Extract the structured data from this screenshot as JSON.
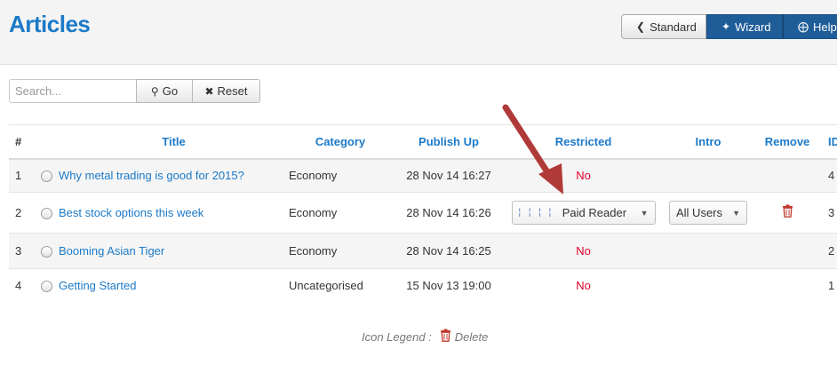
{
  "page": {
    "title": "Articles"
  },
  "toolbar": {
    "standard_label": "Standard",
    "wizard_label": "Wizard",
    "help_label": "Help",
    "standard_icon": "chevron-left-icon",
    "wizard_icon": "magic-wand-icon",
    "help_icon": "lifebuoy-icon"
  },
  "search": {
    "placeholder": "Search...",
    "value": "",
    "go_label": "Go",
    "reset_label": "Reset",
    "go_icon": "search-icon",
    "reset_icon": "close-icon"
  },
  "table": {
    "headers": [
      "#",
      "Title",
      "Category",
      "Publish Up",
      "Restricted",
      "Intro",
      "Remove",
      "ID"
    ],
    "rows": [
      {
        "num": "1",
        "title": "Why metal trading is good for 2015?",
        "category": "Economy",
        "publish_up": "28 Nov 14 16:27",
        "restricted": "No",
        "id": "4"
      },
      {
        "num": "2",
        "title": "Best stock options this week",
        "category": "Economy",
        "publish_up": "28 Nov 14 16:26",
        "restricted_select": "Paid Reader",
        "restricted_prefix": "¦ ¦ ¦ ¦",
        "intro_select": "All Users",
        "id": "3"
      },
      {
        "num": "3",
        "title": "Booming Asian Tiger",
        "category": "Economy",
        "publish_up": "28 Nov 14 16:25",
        "restricted": "No",
        "id": "2"
      },
      {
        "num": "4",
        "title": "Getting Started",
        "category": "Uncategorised",
        "publish_up": "15 Nov 13 19:00",
        "restricted": "No",
        "id": "1"
      }
    ]
  },
  "legend": {
    "label": "Icon Legend :",
    "delete_label": "Delete",
    "delete_icon": "trash-icon"
  },
  "colors": {
    "title_blue": "#1c7ac8",
    "primary_button": "#1f5d99",
    "no_red": "#e3002a",
    "delete_red": "#c0392b",
    "annotation_arrow": "#b03a38"
  }
}
